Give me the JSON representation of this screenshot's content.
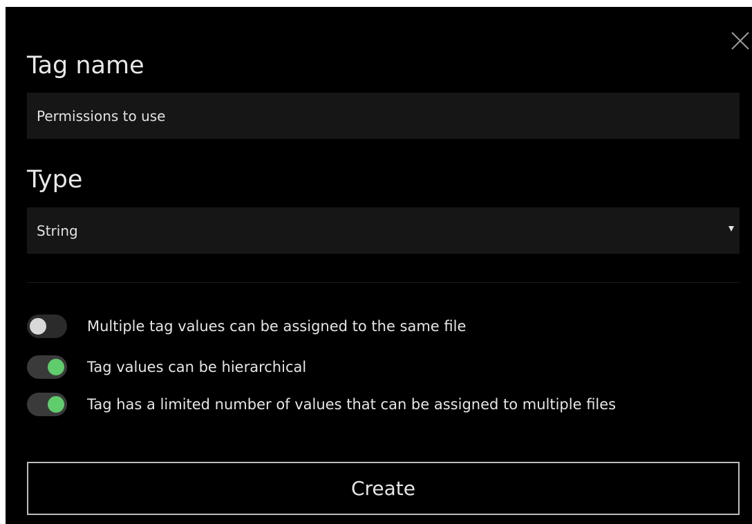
{
  "dialog": {
    "close_icon": "close-icon",
    "tag_name": {
      "title": "Tag name",
      "value": "Permissions to use"
    },
    "type": {
      "title": "Type",
      "selected": "String",
      "arrow_icon": "dropdown-arrow-icon"
    },
    "options": [
      {
        "label": "Multiple tag values can be assigned to the same file",
        "enabled": false
      },
      {
        "label": "Tag values can be hierarchical",
        "enabled": true
      },
      {
        "label": "Tag has a limited number of values that can be assigned to multiple files",
        "enabled": true
      }
    ],
    "create_label": "Create",
    "colors": {
      "background": "#000000",
      "field": "#161616",
      "toggle_on": "#5fcd6b",
      "toggle_off_knob": "#d8d8d8",
      "button_border": "#bdbdbd"
    }
  }
}
